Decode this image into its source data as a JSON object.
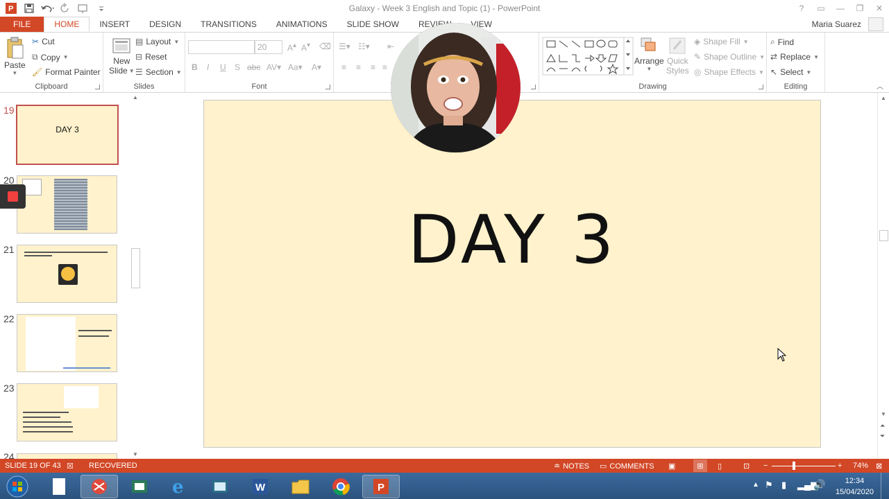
{
  "window": {
    "title": "Galaxy - Week 3 English and Topic (1) - PowerPoint"
  },
  "tabs": [
    "FILE",
    "HOME",
    "INSERT",
    "DESIGN",
    "TRANSITIONS",
    "ANIMATIONS",
    "SLIDE SHOW",
    "REVIEW",
    "VIEW"
  ],
  "user": {
    "name": "Maria Suarez"
  },
  "ribbon": {
    "clipboard": {
      "label": "Clipboard",
      "paste": "Paste",
      "cut": "Cut",
      "copy": "Copy",
      "format_painter": "Format Painter"
    },
    "slides": {
      "label": "Slides",
      "new_slide_1": "New",
      "new_slide_2": "Slide",
      "layout": "Layout",
      "reset": "Reset",
      "section": "Section"
    },
    "font": {
      "label": "Font",
      "font_name": "",
      "font_size": "20"
    },
    "drawing": {
      "label": "Drawing",
      "arrange": "Arrange",
      "quick_styles_1": "Quick",
      "quick_styles_2": "Styles",
      "shape_fill": "Shape Fill",
      "shape_outline": "Shape Outline",
      "shape_effects": "Shape Effects"
    },
    "editing": {
      "label": "Editing",
      "find": "Find",
      "replace": "Replace",
      "select": "Select"
    }
  },
  "slides_pane": {
    "thumbnails": [
      {
        "number": "19",
        "text": "DAY 3"
      },
      {
        "number": "20",
        "text": ""
      },
      {
        "number": "21",
        "text": ""
      },
      {
        "number": "22",
        "text": ""
      },
      {
        "number": "23",
        "text": ""
      },
      {
        "number": "24",
        "text": ""
      }
    ]
  },
  "slide": {
    "title": "DAY 3"
  },
  "statusbar": {
    "slide_info": "SLIDE 19 OF 43",
    "recovered": "RECOVERED",
    "notes": "NOTES",
    "comments": "COMMENTS",
    "zoom": "74%"
  },
  "taskbar": {
    "time": "12:34",
    "date": "15/04/2020"
  },
  "colors": {
    "accent": "#d24726",
    "slide_bg": "#fff2cc",
    "selected_thumb": "#c0504d"
  }
}
